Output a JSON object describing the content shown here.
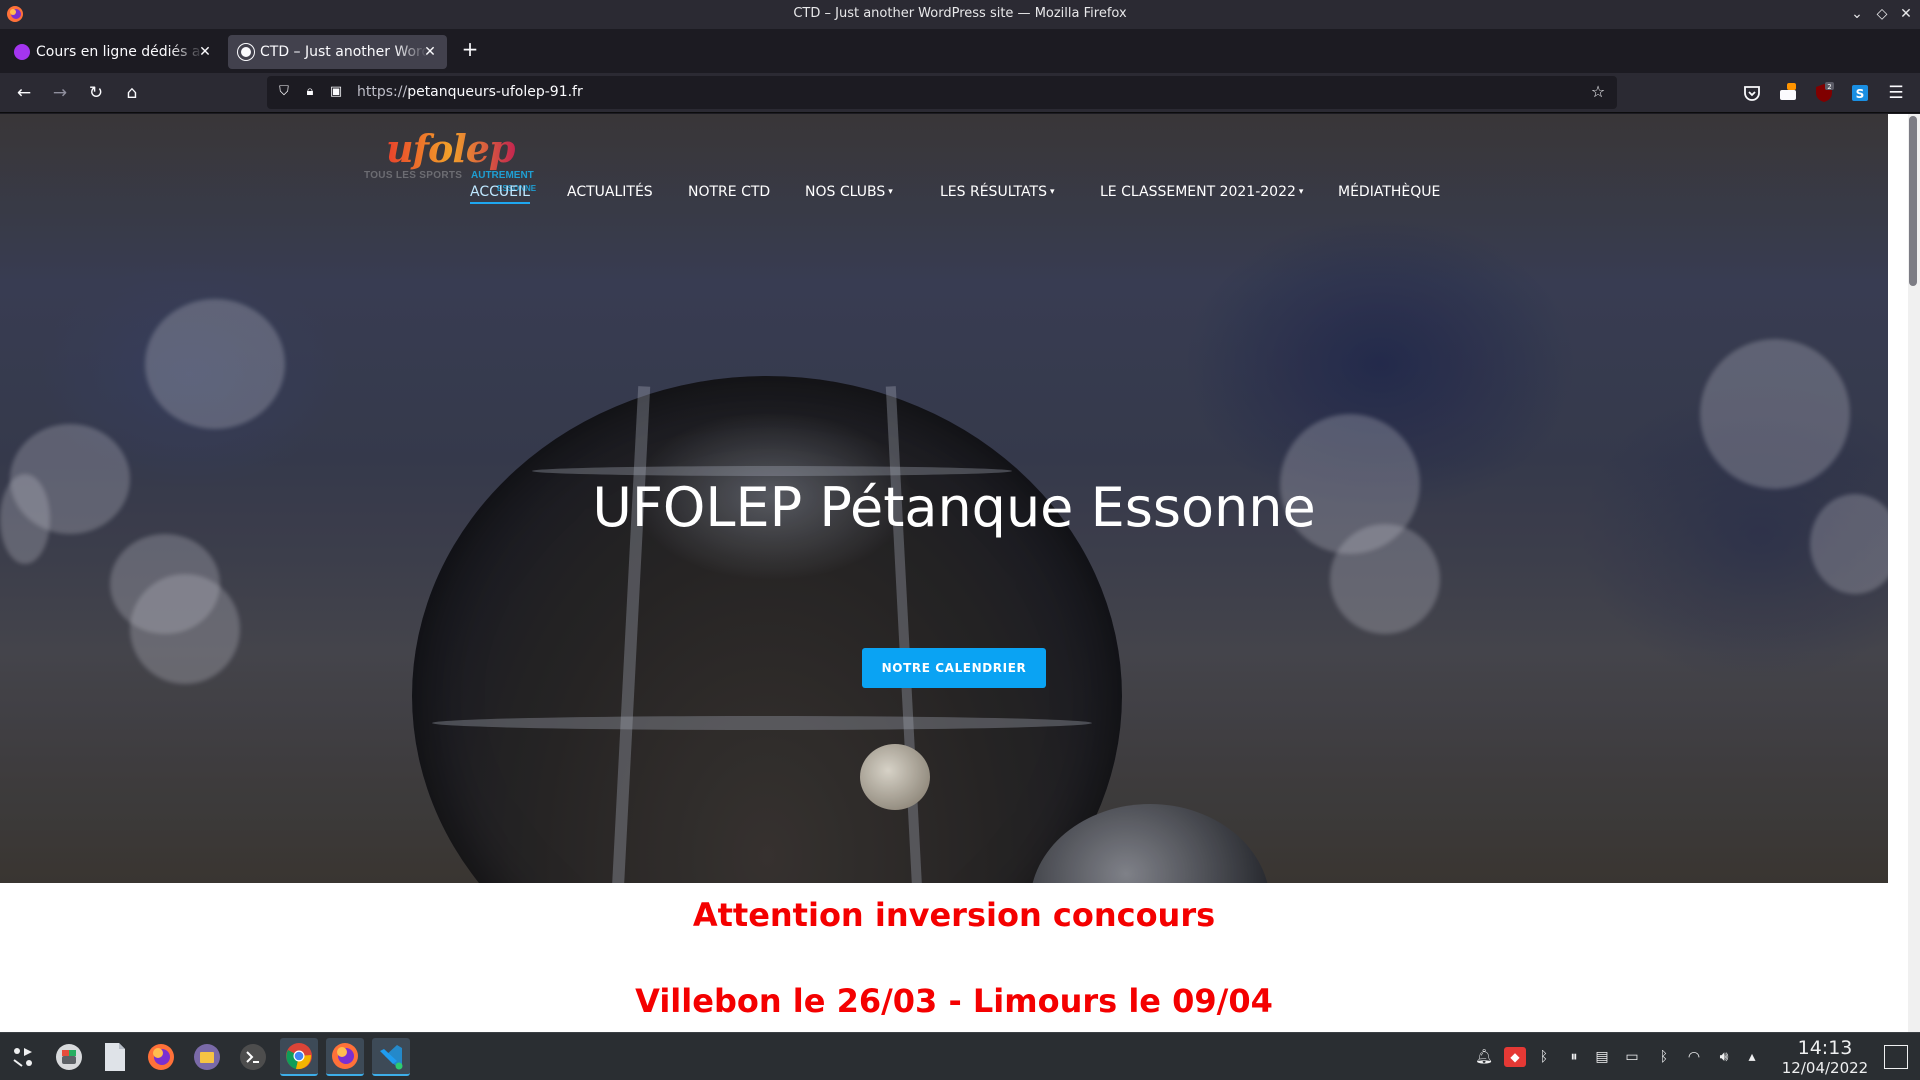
{
  "window": {
    "title": "CTD – Just another WordPress site — Mozilla Firefox",
    "controls": [
      "chevron-down-icon",
      "diamond-icon",
      "close-icon"
    ]
  },
  "tabs": [
    {
      "label": "Cours en ligne dédiés au",
      "favicon": "udemy-icon",
      "active": false
    },
    {
      "label": "CTD – Just another WordPress site",
      "favicon": "wordpress-icon",
      "active": true
    }
  ],
  "navbar": {
    "url_proto": "https://",
    "url_host": "petanqueurs-ufolep-91.fr",
    "badges": {
      "extension_a": "",
      "extension_b": "2"
    }
  },
  "site": {
    "logo": {
      "name": "ufolep",
      "tagline_a": "TOUS LES SPORTS",
      "tagline_b": "AUTREMENT",
      "tagline_c": "ESSONNE"
    },
    "menu": [
      {
        "label": "ACCUEIL",
        "current": true,
        "dropdown": false
      },
      {
        "label": "ACTUALITÉS",
        "current": false,
        "dropdown": false
      },
      {
        "label": "NOTRE CTD",
        "current": false,
        "dropdown": false
      },
      {
        "label": "NOS CLUBS",
        "current": false,
        "dropdown": true
      },
      {
        "label": "LES RÉSULTATS",
        "current": false,
        "dropdown": true
      },
      {
        "label": "LE CLASSEMENT 2021-2022",
        "current": false,
        "dropdown": true
      },
      {
        "label": "MÉDIATHÈQUE",
        "current": false,
        "dropdown": false
      }
    ],
    "hero_title": "UFOLEP Pétanque Essonne",
    "hero_button": "NOTRE CALENDRIER",
    "notice_line1": "Attention inversion concours",
    "notice_line2": "Villebon le 26/03 - Limours le 09/04",
    "colors": {
      "accent": "#0aa3f3",
      "notice": "#f40000"
    }
  },
  "taskbar": {
    "apps": [
      "launcher-icon",
      "discover-icon",
      "text-file-icon",
      "firefox-icon",
      "files-icon",
      "terminal-icon",
      "chrome-icon",
      "firefox-icon",
      "vscode-icon"
    ],
    "time": "14:13",
    "date": "12/04/2022"
  }
}
